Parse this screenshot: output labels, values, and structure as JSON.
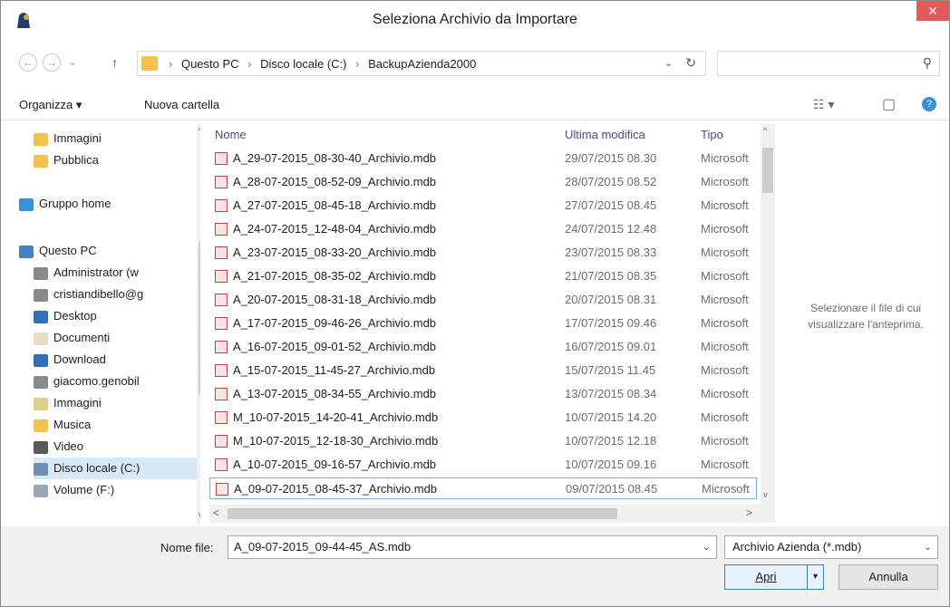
{
  "window": {
    "title": "Seleziona Archivio da Importare",
    "close_glyph": "✕",
    "accent": "#e05b5b"
  },
  "nav": {
    "back_glyph": "←",
    "forward_glyph": "→",
    "recent_glyph": "⌄",
    "up_glyph": "↑",
    "breadcrumb": [
      "Questo PC",
      "Disco locale (C:)",
      "BackupAzienda2000"
    ],
    "sep": "›",
    "dropdown_glyph": "⌄",
    "refresh_glyph": "↻",
    "search_placeholder": "",
    "search_glyph": "⚲"
  },
  "toolbar": {
    "organize": "Organizza ▾",
    "new_folder": "Nuova cartella",
    "view_glyph": "☷ ▾",
    "pane_glyph": "▢",
    "help_glyph": "?"
  },
  "navpane": {
    "items": [
      {
        "label": "Immagini",
        "icon": "folder-icon",
        "color": "#f1c34e"
      },
      {
        "label": "Pubblica",
        "icon": "folder-icon",
        "color": "#f1c34e"
      },
      {
        "label": "Gruppo home",
        "icon": "homegroup-icon",
        "color": "#3a8fd9"
      },
      {
        "label": "Questo PC",
        "icon": "computer-icon",
        "color": "#4a7fc1"
      },
      {
        "label": "Administrator (w",
        "icon": "network-user-icon",
        "color": "#8a8a8a"
      },
      {
        "label": "cristiandibello@g",
        "icon": "network-user-icon",
        "color": "#8a8a8a"
      },
      {
        "label": "Desktop",
        "icon": "desktop-icon",
        "color": "#2f6fb5"
      },
      {
        "label": "Documenti",
        "icon": "documents-icon",
        "color": "#e8dcc0"
      },
      {
        "label": "Download",
        "icon": "download-icon",
        "color": "#2f6fb5"
      },
      {
        "label": "giacomo.genobil",
        "icon": "network-user-icon",
        "color": "#8a8a8a"
      },
      {
        "label": "Immagini",
        "icon": "pictures-icon",
        "color": "#e0cf8a"
      },
      {
        "label": "Musica",
        "icon": "music-icon",
        "color": "#f1c34e"
      },
      {
        "label": "Video",
        "icon": "video-icon",
        "color": "#5a5a5a"
      },
      {
        "label": "Disco locale (C:)",
        "icon": "drive-icon",
        "color": "#6d8fb5"
      },
      {
        "label": "Volume (F:)",
        "icon": "drive-icon",
        "color": "#9aa8b5"
      }
    ],
    "up_glyph": "^",
    "down_glyph": "v"
  },
  "filelist": {
    "columns": {
      "name": "Nome",
      "modified": "Ultima modifica",
      "type": "Tipo"
    },
    "rows": [
      {
        "name": "A_29-07-2015_08-30-40_Archivio.mdb",
        "modified": "29/07/2015 08.30",
        "type": "Microsoft"
      },
      {
        "name": "A_28-07-2015_08-52-09_Archivio.mdb",
        "modified": "28/07/2015 08.52",
        "type": "Microsoft"
      },
      {
        "name": "A_27-07-2015_08-45-18_Archivio.mdb",
        "modified": "27/07/2015 08.45",
        "type": "Microsoft"
      },
      {
        "name": "A_24-07-2015_12-48-04_Archivio.mdb",
        "modified": "24/07/2015 12.48",
        "type": "Microsoft"
      },
      {
        "name": "A_23-07-2015_08-33-20_Archivio.mdb",
        "modified": "23/07/2015 08.33",
        "type": "Microsoft"
      },
      {
        "name": "A_21-07-2015_08-35-02_Archivio.mdb",
        "modified": "21/07/2015 08.35",
        "type": "Microsoft"
      },
      {
        "name": "A_20-07-2015_08-31-18_Archivio.mdb",
        "modified": "20/07/2015 08.31",
        "type": "Microsoft"
      },
      {
        "name": "A_17-07-2015_09-46-26_Archivio.mdb",
        "modified": "17/07/2015 09.46",
        "type": "Microsoft"
      },
      {
        "name": "A_16-07-2015_09-01-52_Archivio.mdb",
        "modified": "16/07/2015 09.01",
        "type": "Microsoft"
      },
      {
        "name": "A_15-07-2015_11-45-27_Archivio.mdb",
        "modified": "15/07/2015 11.45",
        "type": "Microsoft"
      },
      {
        "name": "A_13-07-2015_08-34-55_Archivio.mdb",
        "modified": "13/07/2015 08.34",
        "type": "Microsoft"
      },
      {
        "name": "M_10-07-2015_14-20-41_Archivio.mdb",
        "modified": "10/07/2015 14.20",
        "type": "Microsoft"
      },
      {
        "name": "M_10-07-2015_12-18-30_Archivio.mdb",
        "modified": "10/07/2015 12.18",
        "type": "Microsoft"
      },
      {
        "name": "A_10-07-2015_09-16-57_Archivio.mdb",
        "modified": "10/07/2015 09.16",
        "type": "Microsoft"
      },
      {
        "name": "A_09-07-2015_08-45-37_Archivio.mdb",
        "modified": "09/07/2015 08.45",
        "type": "Microsoft"
      }
    ],
    "up_glyph": "^",
    "down_glyph": "v",
    "left_glyph": "<",
    "right_glyph": ">"
  },
  "preview": {
    "message": "Selezionare il file di cui visualizzare l'anteprima."
  },
  "footer": {
    "filename_label": "Nome file:",
    "filename_value": "A_09-07-2015_09-44-45_AS.mdb",
    "dropdown_glyph": "⌄",
    "filter_value": "Archivio Azienda (*.mdb)",
    "open_label": "Apri",
    "open_arrow": "▾",
    "cancel_label": "Annulla"
  }
}
